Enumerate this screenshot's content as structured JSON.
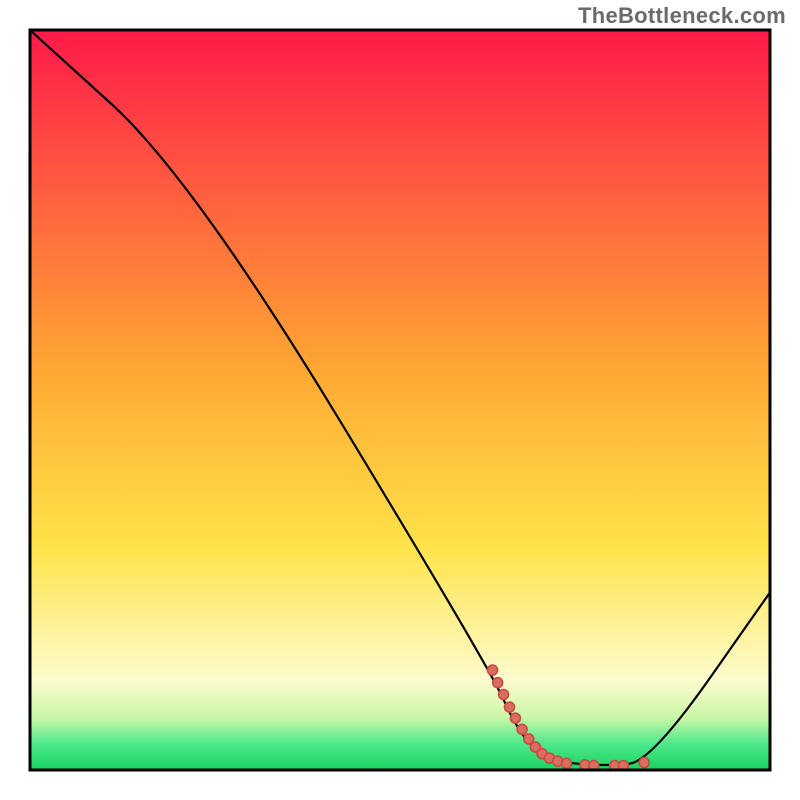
{
  "watermark": "TheBottleneck.com",
  "colors": {
    "gradient_top": "#ff1a49",
    "gradient_mid": "#ffd23a",
    "gradient_green": "#1fe06a",
    "gradient_green_light": "#b0f7c1",
    "curve_stroke": "#000000",
    "dots_stroke": "#c94a42",
    "dots_fill": "#da6f5f",
    "border": "#000000"
  },
  "chart_data": {
    "type": "line",
    "title": "",
    "xlabel": "",
    "ylabel": "",
    "xlim": [
      0,
      100
    ],
    "ylim": [
      0,
      100
    ],
    "curve": [
      {
        "x": 0,
        "y": 100
      },
      {
        "x": 22,
        "y": 80
      },
      {
        "x": 62,
        "y": 14
      },
      {
        "x": 66,
        "y": 5
      },
      {
        "x": 70,
        "y": 1.2
      },
      {
        "x": 78,
        "y": 0.5
      },
      {
        "x": 84,
        "y": 1.2
      },
      {
        "x": 100,
        "y": 24
      }
    ],
    "dots": [
      {
        "x": 62.5,
        "y": 13.5,
        "r": 5
      },
      {
        "x": 63.2,
        "y": 11.8,
        "r": 5
      },
      {
        "x": 64.0,
        "y": 10.2,
        "r": 5
      },
      {
        "x": 64.8,
        "y": 8.5,
        "r": 5
      },
      {
        "x": 65.6,
        "y": 7.0,
        "r": 5
      },
      {
        "x": 66.5,
        "y": 5.5,
        "r": 5
      },
      {
        "x": 67.4,
        "y": 4.2,
        "r": 5
      },
      {
        "x": 68.3,
        "y": 3.1,
        "r": 5
      },
      {
        "x": 69.2,
        "y": 2.2,
        "r": 5
      },
      {
        "x": 70.2,
        "y": 1.6,
        "r": 5
      },
      {
        "x": 71.3,
        "y": 1.2,
        "r": 5
      },
      {
        "x": 72.5,
        "y": 0.9,
        "r": 5
      },
      {
        "x": 75.0,
        "y": 0.7,
        "r": 5
      },
      {
        "x": 76.2,
        "y": 0.6,
        "r": 5
      },
      {
        "x": 79.0,
        "y": 0.6,
        "r": 5
      },
      {
        "x": 80.2,
        "y": 0.6,
        "r": 5
      },
      {
        "x": 83.0,
        "y": 1.0,
        "r": 5
      }
    ]
  }
}
